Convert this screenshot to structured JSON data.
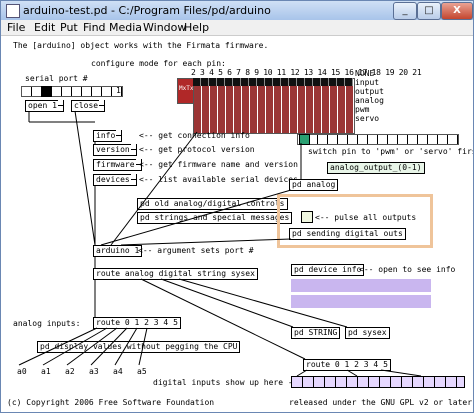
{
  "window": {
    "title": "arduino-test.pd - C:/Program Files/pd/arduino",
    "min_label": "_",
    "max_label": "□",
    "close_label": "X"
  },
  "menubar": [
    "File",
    "Edit",
    "Put",
    "Find",
    "Media",
    "Window",
    "Help"
  ],
  "patch": {
    "intro": "The [arduino] object works with the Firmata firmware.",
    "configure_label": "configure mode for each pin:",
    "pin_numbers": "2 3 4 5 6 7 8 9 10 11 12 13 14 15 16 17 18 19 20 21",
    "mode_options": [
      "NONE",
      "input",
      "output",
      "analog",
      "pwm",
      "servo"
    ],
    "serial_port_label": "serial port #",
    "serial_port_value": "1",
    "open_label": "open 1",
    "close_label": "close",
    "msg_info": "info",
    "msg_version": "version",
    "msg_firmware": "firmware",
    "msg_devices": "devices",
    "comment_info": "<-- get connection info",
    "comment_version": "<-- get protocol version",
    "comment_firmware": "<-- get firmware name and version",
    "comment_devices": "<-- list available serial devices",
    "pd_old": "pd old analog/digital controls",
    "pd_strings": "pd strings and special messages",
    "arduino_obj": "arduino 1",
    "comment_arg": "<-- argument sets port #",
    "route_main": "route analog digital string sysex",
    "pd_device_info": "pd device info",
    "comment_open": "<-- open to see info",
    "switch_pin_label": "switch pin to 'pwm' or 'servo' first",
    "analog_output": "analog_output_(0-1)",
    "pd_analog": "pd analog",
    "comment_pulse": "<-- pulse all outputs",
    "pd_sending": "pd sending digital outs",
    "analog_inputs_label": "analog inputs:",
    "route_analog": "route 0 1 2 3 4 5",
    "pd_display": "pd display values without pegging the CPU",
    "analog_labels": [
      "a0",
      "a1",
      "a2",
      "a3",
      "a4",
      "a5"
    ],
    "pd_string": "pd STRING",
    "pd_sysex": "pd sysex",
    "route_digital": "route 0 1 2 3 4 5",
    "digital_comment": "digital inputs show up here -->",
    "copyright": "(c) Copyright 2006 Free Software Foundation",
    "license": "released under the GNU GPL v2 or later"
  }
}
